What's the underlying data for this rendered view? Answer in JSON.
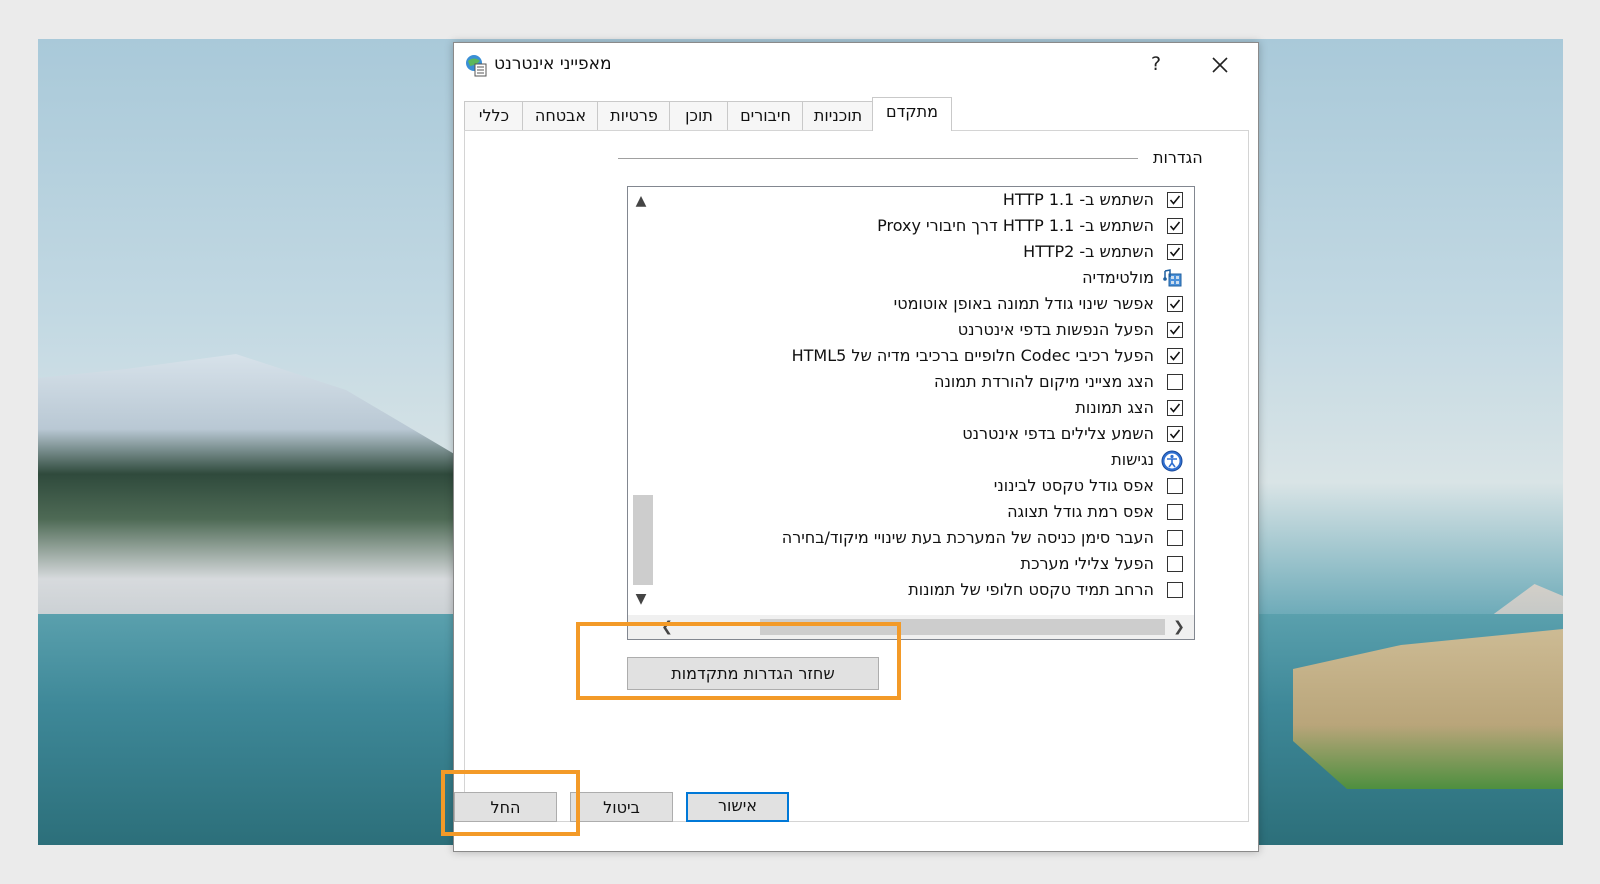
{
  "window": {
    "title": "מאפייני אינטרנט",
    "help_label": "?",
    "close_icon": "close-icon"
  },
  "tabs": [
    {
      "label": "כללי"
    },
    {
      "label": "אבטחה"
    },
    {
      "label": "פרטיות"
    },
    {
      "label": "תוכן"
    },
    {
      "label": "חיבורים"
    },
    {
      "label": "תוכניות"
    },
    {
      "label": "מתקדם",
      "active": true
    }
  ],
  "settings": {
    "group_label": "הגדרות",
    "items": [
      {
        "type": "checkbox",
        "checked": true,
        "label": "השתמש ב- HTTP 1.1"
      },
      {
        "type": "checkbox",
        "checked": true,
        "label": "השתמש ב- HTTP 1.1 דרך חיבורי Proxy"
      },
      {
        "type": "checkbox",
        "checked": true,
        "label": "השתמש ב- HTTP2"
      },
      {
        "type": "category",
        "icon": "multimedia-icon",
        "label": "מולטימדיה"
      },
      {
        "type": "checkbox",
        "checked": true,
        "label": "אפשר שינוי גודל תמונה באופן אוטומטי"
      },
      {
        "type": "checkbox",
        "checked": true,
        "label": "הפעל הנפשות בדפי אינטרנט"
      },
      {
        "type": "checkbox",
        "checked": true,
        "label": "הפעל רכיבי Codec חלופיים ברכיבי מדיה של HTML5"
      },
      {
        "type": "checkbox",
        "checked": false,
        "label": "הצג מצייני מיקום להורדת תמונה"
      },
      {
        "type": "checkbox",
        "checked": true,
        "label": "הצג תמונות"
      },
      {
        "type": "checkbox",
        "checked": true,
        "label": "השמע צלילים בדפי אינטרנט"
      },
      {
        "type": "category",
        "icon": "accessibility-icon",
        "label": "נגישות"
      },
      {
        "type": "checkbox",
        "checked": false,
        "label": "אפס גודל טקסט לבינוני"
      },
      {
        "type": "checkbox",
        "checked": false,
        "label": "אפס רמת גודל תצוגה"
      },
      {
        "type": "checkbox",
        "checked": false,
        "label": "העבר סימן כניסה של המערכת בעת שינויי מיקוד/בחירה"
      },
      {
        "type": "checkbox",
        "checked": false,
        "label": "הפעל צלילי מערכת"
      },
      {
        "type": "checkbox",
        "checked": false,
        "label": "הרחב תמיד טקסט חלופי של תמונות"
      }
    ]
  },
  "restore_button_label": "שחזר הגדרות מתקדמות",
  "footer": {
    "ok_label": "אישור",
    "cancel_label": "ביטול",
    "apply_label": "החל"
  },
  "colors": {
    "highlight": "#f39a28",
    "primary_border": "#0078d7"
  }
}
